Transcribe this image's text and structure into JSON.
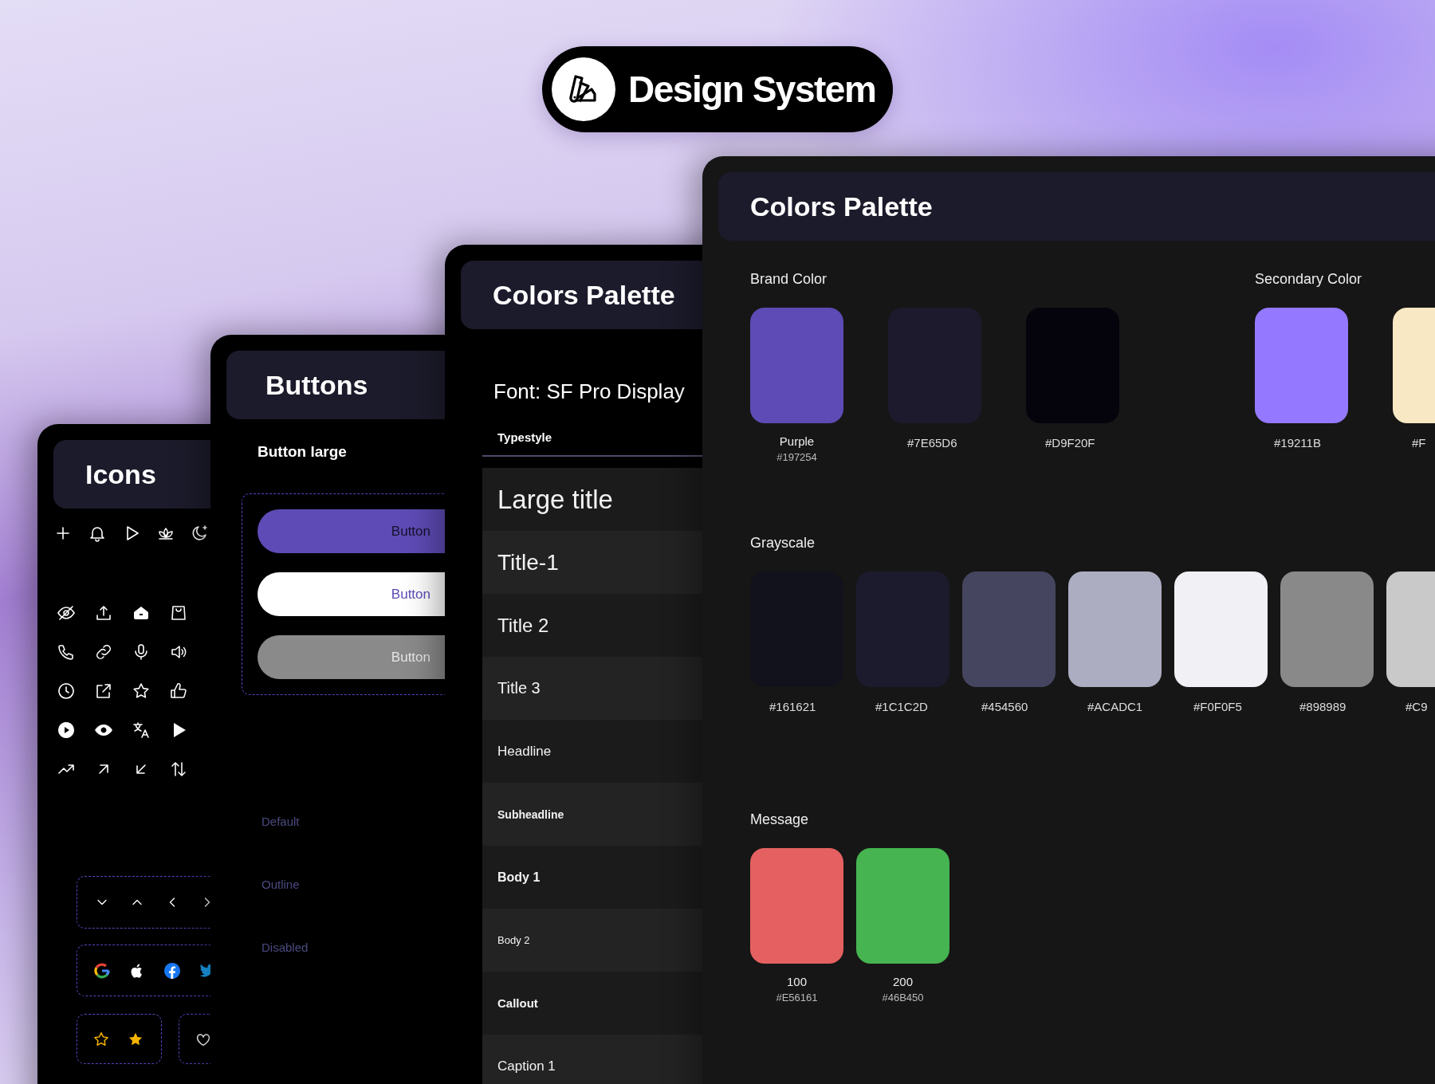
{
  "badge": {
    "title": "Design System"
  },
  "icons_card": {
    "title": "Icons"
  },
  "buttons_card": {
    "title": "Buttons",
    "section": "Button large",
    "buttons": [
      {
        "label": "Button",
        "kind": "primary"
      },
      {
        "label": "Button",
        "kind": "outline"
      },
      {
        "label": "Button",
        "kind": "disabled"
      }
    ],
    "state_labels": [
      "Default",
      "Outline",
      "Disabled"
    ]
  },
  "typography_card": {
    "title": "Colors Palette",
    "font": "Font: SF Pro Display",
    "column": "Typestyle",
    "styles": [
      {
        "name": "Large title",
        "kind": "large-title"
      },
      {
        "name": "Title-1",
        "kind": "title1"
      },
      {
        "name": "Title 2",
        "kind": "title2"
      },
      {
        "name": "Title 3",
        "kind": "title3"
      },
      {
        "name": "Headline",
        "kind": "headline"
      },
      {
        "name": "Subheadline",
        "kind": "subheadline"
      },
      {
        "name": "Body 1",
        "kind": "body1"
      },
      {
        "name": "Body 2",
        "kind": "body2"
      },
      {
        "name": "Callout",
        "kind": "callout"
      },
      {
        "name": "Caption 1",
        "kind": "caption1"
      }
    ]
  },
  "colors_card": {
    "title": "Colors Palette",
    "rows": [
      {
        "groups": [
          {
            "title": "Brand Color",
            "swatches": [
              {
                "name": "Purple",
                "code": "#197254",
                "color": "#5e4bb5"
              },
              {
                "code": "#7E65D6",
                "color": "#1c1a2c"
              },
              {
                "code": "#D9F20F",
                "color": "#05040c"
              }
            ]
          },
          {
            "title": "Secondary Color",
            "swatches": [
              {
                "code": "#19211B",
                "color": "#9478ff"
              },
              {
                "code": "#F",
                "color": "#f8e8c4"
              }
            ]
          }
        ]
      },
      {
        "groups": [
          {
            "title": "Grayscale",
            "swatches": [
              {
                "code": "#161621",
                "color": "#12121c"
              },
              {
                "code": "#1C1C2D",
                "color": "#1c1b2d"
              },
              {
                "code": "#454560",
                "color": "#454560"
              },
              {
                "code": "#ACADC1",
                "color": "#acadc1"
              },
              {
                "code": "#F0F0F5",
                "color": "#f0f0f5"
              },
              {
                "code": "#898989",
                "color": "#898989"
              },
              {
                "code": "#C9",
                "color": "#c9c9c9"
              }
            ]
          }
        ]
      },
      {
        "groups": [
          {
            "title": "Message",
            "swatches": [
              {
                "name": "100",
                "code": "#E56161",
                "color": "#e56161"
              },
              {
                "name": "200",
                "code": "#46B450",
                "color": "#46b450"
              }
            ]
          }
        ]
      }
    ]
  }
}
